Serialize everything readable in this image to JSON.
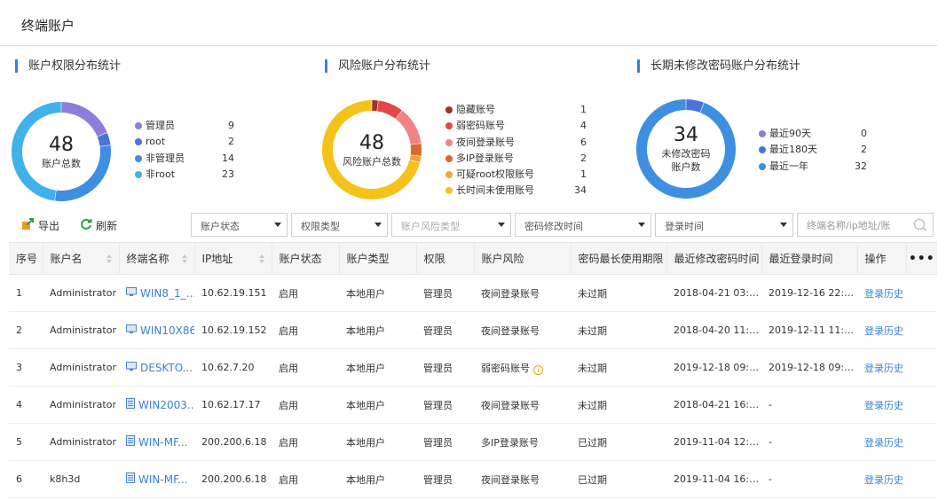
{
  "page": {
    "title": "终端账户"
  },
  "colors": {
    "accent": "#3b7fd6"
  },
  "charts": [
    {
      "title": "账户权限分布统计",
      "total": "48",
      "center_label": "账户总数",
      "items": [
        {
          "name": "管理员",
          "value": 9,
          "color": "#8c7fd9"
        },
        {
          "name": "root",
          "value": 2,
          "color": "#4a74d6"
        },
        {
          "name": "非管理员",
          "value": 14,
          "color": "#3f8fe0"
        },
        {
          "name": "非root",
          "value": 23,
          "color": "#41b1ea"
        }
      ]
    },
    {
      "title": "风险账户分布统计",
      "total": "48",
      "center_label": "风险账户总数",
      "items": [
        {
          "name": "隐藏账号",
          "value": 1,
          "color": "#9e3324"
        },
        {
          "name": "弱密码账号",
          "value": 4,
          "color": "#e54646"
        },
        {
          "name": "夜间登录账号",
          "value": 6,
          "color": "#f28383"
        },
        {
          "name": "多IP登录账号",
          "value": 2,
          "color": "#d86a2a"
        },
        {
          "name": "可疑root权限账号",
          "value": 1,
          "color": "#f3a13d"
        },
        {
          "name": "长时间未使用账号",
          "value": 34,
          "color": "#f5c21b"
        }
      ]
    },
    {
      "title": "长期未修改密码账户分布统计",
      "total": "34",
      "center_label": "未修改密码",
      "center_label2": "账户数",
      "items": [
        {
          "name": "最近90天",
          "value": 0,
          "color": "#8c7fd9"
        },
        {
          "name": "最近180天",
          "value": 2,
          "color": "#4a74d6"
        },
        {
          "name": "最近一年",
          "value": 32,
          "color": "#3f8fe0"
        }
      ]
    }
  ],
  "toolbar": {
    "export_label": "导出",
    "refresh_label": "刷新"
  },
  "filters": {
    "account_status": "账户状态",
    "permission_type": "权限类型",
    "risk_type": "账户风险类型",
    "pwd_time": "密码修改时间",
    "login_time": "登录时间",
    "search_placeholder": "终端名称/ip地址/账"
  },
  "table": {
    "headers": [
      "序号",
      "账户名",
      "终端名称",
      "IP地址",
      "账户状态",
      "账户类型",
      "权限",
      "账户风险",
      "密码最长使用期限",
      "最近修改密码时间",
      "最近登录时间",
      "操作",
      "•••"
    ],
    "rows": [
      {
        "no": "1",
        "account": "Administrator",
        "terminal": "WIN8_1_...",
        "icon": "monitor",
        "ip": "10.62.19.151",
        "status": "启用",
        "type": "本地用户",
        "perm": "管理员",
        "risk": "夜间登录账号",
        "warn": false,
        "pwd_expire": "未过期",
        "pwd_modified": "2018-04-21 03:4...",
        "last_login": "2019-12-16 22:0...",
        "op": "登录历史"
      },
      {
        "no": "2",
        "account": "Administrator",
        "terminal": "WIN10X86",
        "icon": "monitor",
        "ip": "10.62.19.152",
        "status": "启用",
        "type": "本地用户",
        "perm": "管理员",
        "risk": "夜间登录账号",
        "warn": false,
        "pwd_expire": "未过期",
        "pwd_modified": "2018-04-20 11:40...",
        "last_login": "2019-12-11 11:46...",
        "op": "登录历史"
      },
      {
        "no": "3",
        "account": "Administrator",
        "terminal": "DESKTO...",
        "icon": "monitor",
        "ip": "10.62.7.20",
        "status": "启用",
        "type": "本地用户",
        "perm": "管理员",
        "risk": "弱密码账号",
        "warn": true,
        "pwd_expire": "未过期",
        "pwd_modified": "2019-12-18 09:4...",
        "last_login": "2019-12-18 09:4...",
        "op": "登录历史"
      },
      {
        "no": "4",
        "account": "Administrator",
        "terminal": "WIN2003...",
        "icon": "server",
        "ip": "10.62.17.17",
        "status": "启用",
        "type": "本地用户",
        "perm": "管理员",
        "risk": "夜间登录账号",
        "warn": false,
        "pwd_expire": "未过期",
        "pwd_modified": "2018-04-21 16:2...",
        "last_login": "-",
        "op": "登录历史"
      },
      {
        "no": "5",
        "account": "Administrator",
        "terminal": "WIN-MF...",
        "icon": "server",
        "ip": "200.200.6.18",
        "status": "启用",
        "type": "本地用户",
        "perm": "管理员",
        "risk": "多IP登录账号",
        "warn": false,
        "pwd_expire": "已过期",
        "pwd_modified": "2019-11-04 12:16...",
        "last_login": "-",
        "op": "登录历史"
      },
      {
        "no": "6",
        "account": "k8h3d",
        "terminal": "WIN-MF...",
        "icon": "server",
        "ip": "200.200.6.18",
        "status": "启用",
        "type": "本地用户",
        "perm": "管理员",
        "risk": "夜间登录账号",
        "warn": false,
        "pwd_expire": "已过期",
        "pwd_modified": "2019-11-04 16:49...",
        "last_login": "-",
        "op": "登录历史"
      }
    ]
  }
}
